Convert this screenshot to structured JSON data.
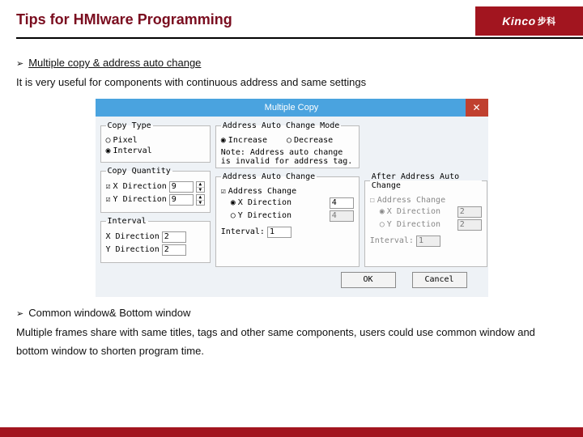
{
  "header": {
    "title": "Tips for HMIware Programming",
    "brand_en": "Kinco",
    "brand_cn": "步科"
  },
  "section1": {
    "bullet": "Multiple copy & address auto change",
    "desc": "It is very useful for components with continuous address and same settings"
  },
  "dialog": {
    "title": "Multiple Copy",
    "copy_type": {
      "legend": "Copy Type",
      "opt_pixel": "Pixel",
      "opt_interval": "Interval"
    },
    "copy_qty": {
      "legend": "Copy Quantity",
      "x_label": "X Direction",
      "y_label": "Y Direction",
      "x_val": "9",
      "y_val": "9"
    },
    "interval": {
      "legend": "Interval",
      "x_label": "X Direction",
      "y_label": "Y Direction",
      "x_val": "2",
      "y_val": "2"
    },
    "mode": {
      "legend": "Address Auto Change Mode",
      "opt_inc": "Increase",
      "opt_dec": "Decrease",
      "note": "Note: Address auto change is invalid for address tag."
    },
    "auto_change": {
      "legend": "Address Auto Change",
      "chk": "Address Change",
      "opt_x": "X Direction",
      "opt_y": "Y Direction",
      "x_val": "4",
      "y_val": "4",
      "interval_lbl": "Interval:",
      "interval_val": "1"
    },
    "after": {
      "legend": "After Address Auto Change",
      "chk": "Address Change",
      "opt_x": "X Direction",
      "opt_y": "Y Direction",
      "x_val": "2",
      "y_val": "2",
      "interval_lbl": "Interval:",
      "interval_val": "1"
    },
    "buttons": {
      "ok": "OK",
      "cancel": "Cancel"
    }
  },
  "section2": {
    "bullet": "Common window& Bottom window",
    "desc": "Multiple frames share with same titles, tags and other same components, users could use common window and bottom window to shorten program time."
  }
}
